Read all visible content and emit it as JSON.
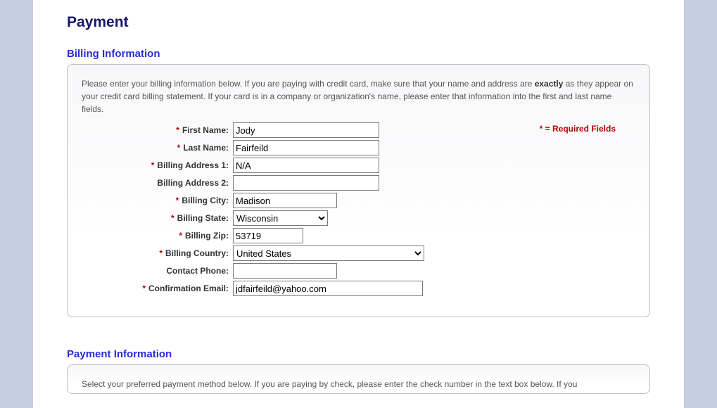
{
  "page_title": "Payment",
  "sections": {
    "billing": {
      "heading": "Billing Information",
      "intro_prefix": "Please enter your billing information below. If you are paying with credit card, make sure that your name and address are ",
      "intro_bold": "exactly",
      "intro_suffix": " as they appear on your credit card billing statement. If your card is in a company or organization's name, please enter that information into the first and last name fields.",
      "required_legend": "= Required Fields",
      "fields": {
        "first_name": {
          "label": "First Name:",
          "value": "Jody"
        },
        "last_name": {
          "label": "Last Name:",
          "value": "Fairfeild"
        },
        "addr1": {
          "label": "Billing Address 1:",
          "value": "N/A"
        },
        "addr2": {
          "label": "Billing Address 2:",
          "value": ""
        },
        "city": {
          "label": "Billing City:",
          "value": "Madison"
        },
        "state": {
          "label": "Billing State:",
          "value": "Wisconsin"
        },
        "zip": {
          "label": "Billing Zip:",
          "value": "53719"
        },
        "country": {
          "label": "Billing Country:",
          "value": "United States"
        },
        "phone": {
          "label": "Contact Phone:",
          "value": ""
        },
        "email": {
          "label": "Confirmation Email:",
          "value": "jdfairfeild@yahoo.com"
        }
      }
    },
    "payment": {
      "heading": "Payment Information",
      "intro": "Select your preferred payment method below. If you are paying by check, please enter the check number in the text box below. If you"
    }
  },
  "colors": {
    "heading1": "#17176b",
    "heading2": "#2b2bda",
    "required": "#b30000"
  }
}
